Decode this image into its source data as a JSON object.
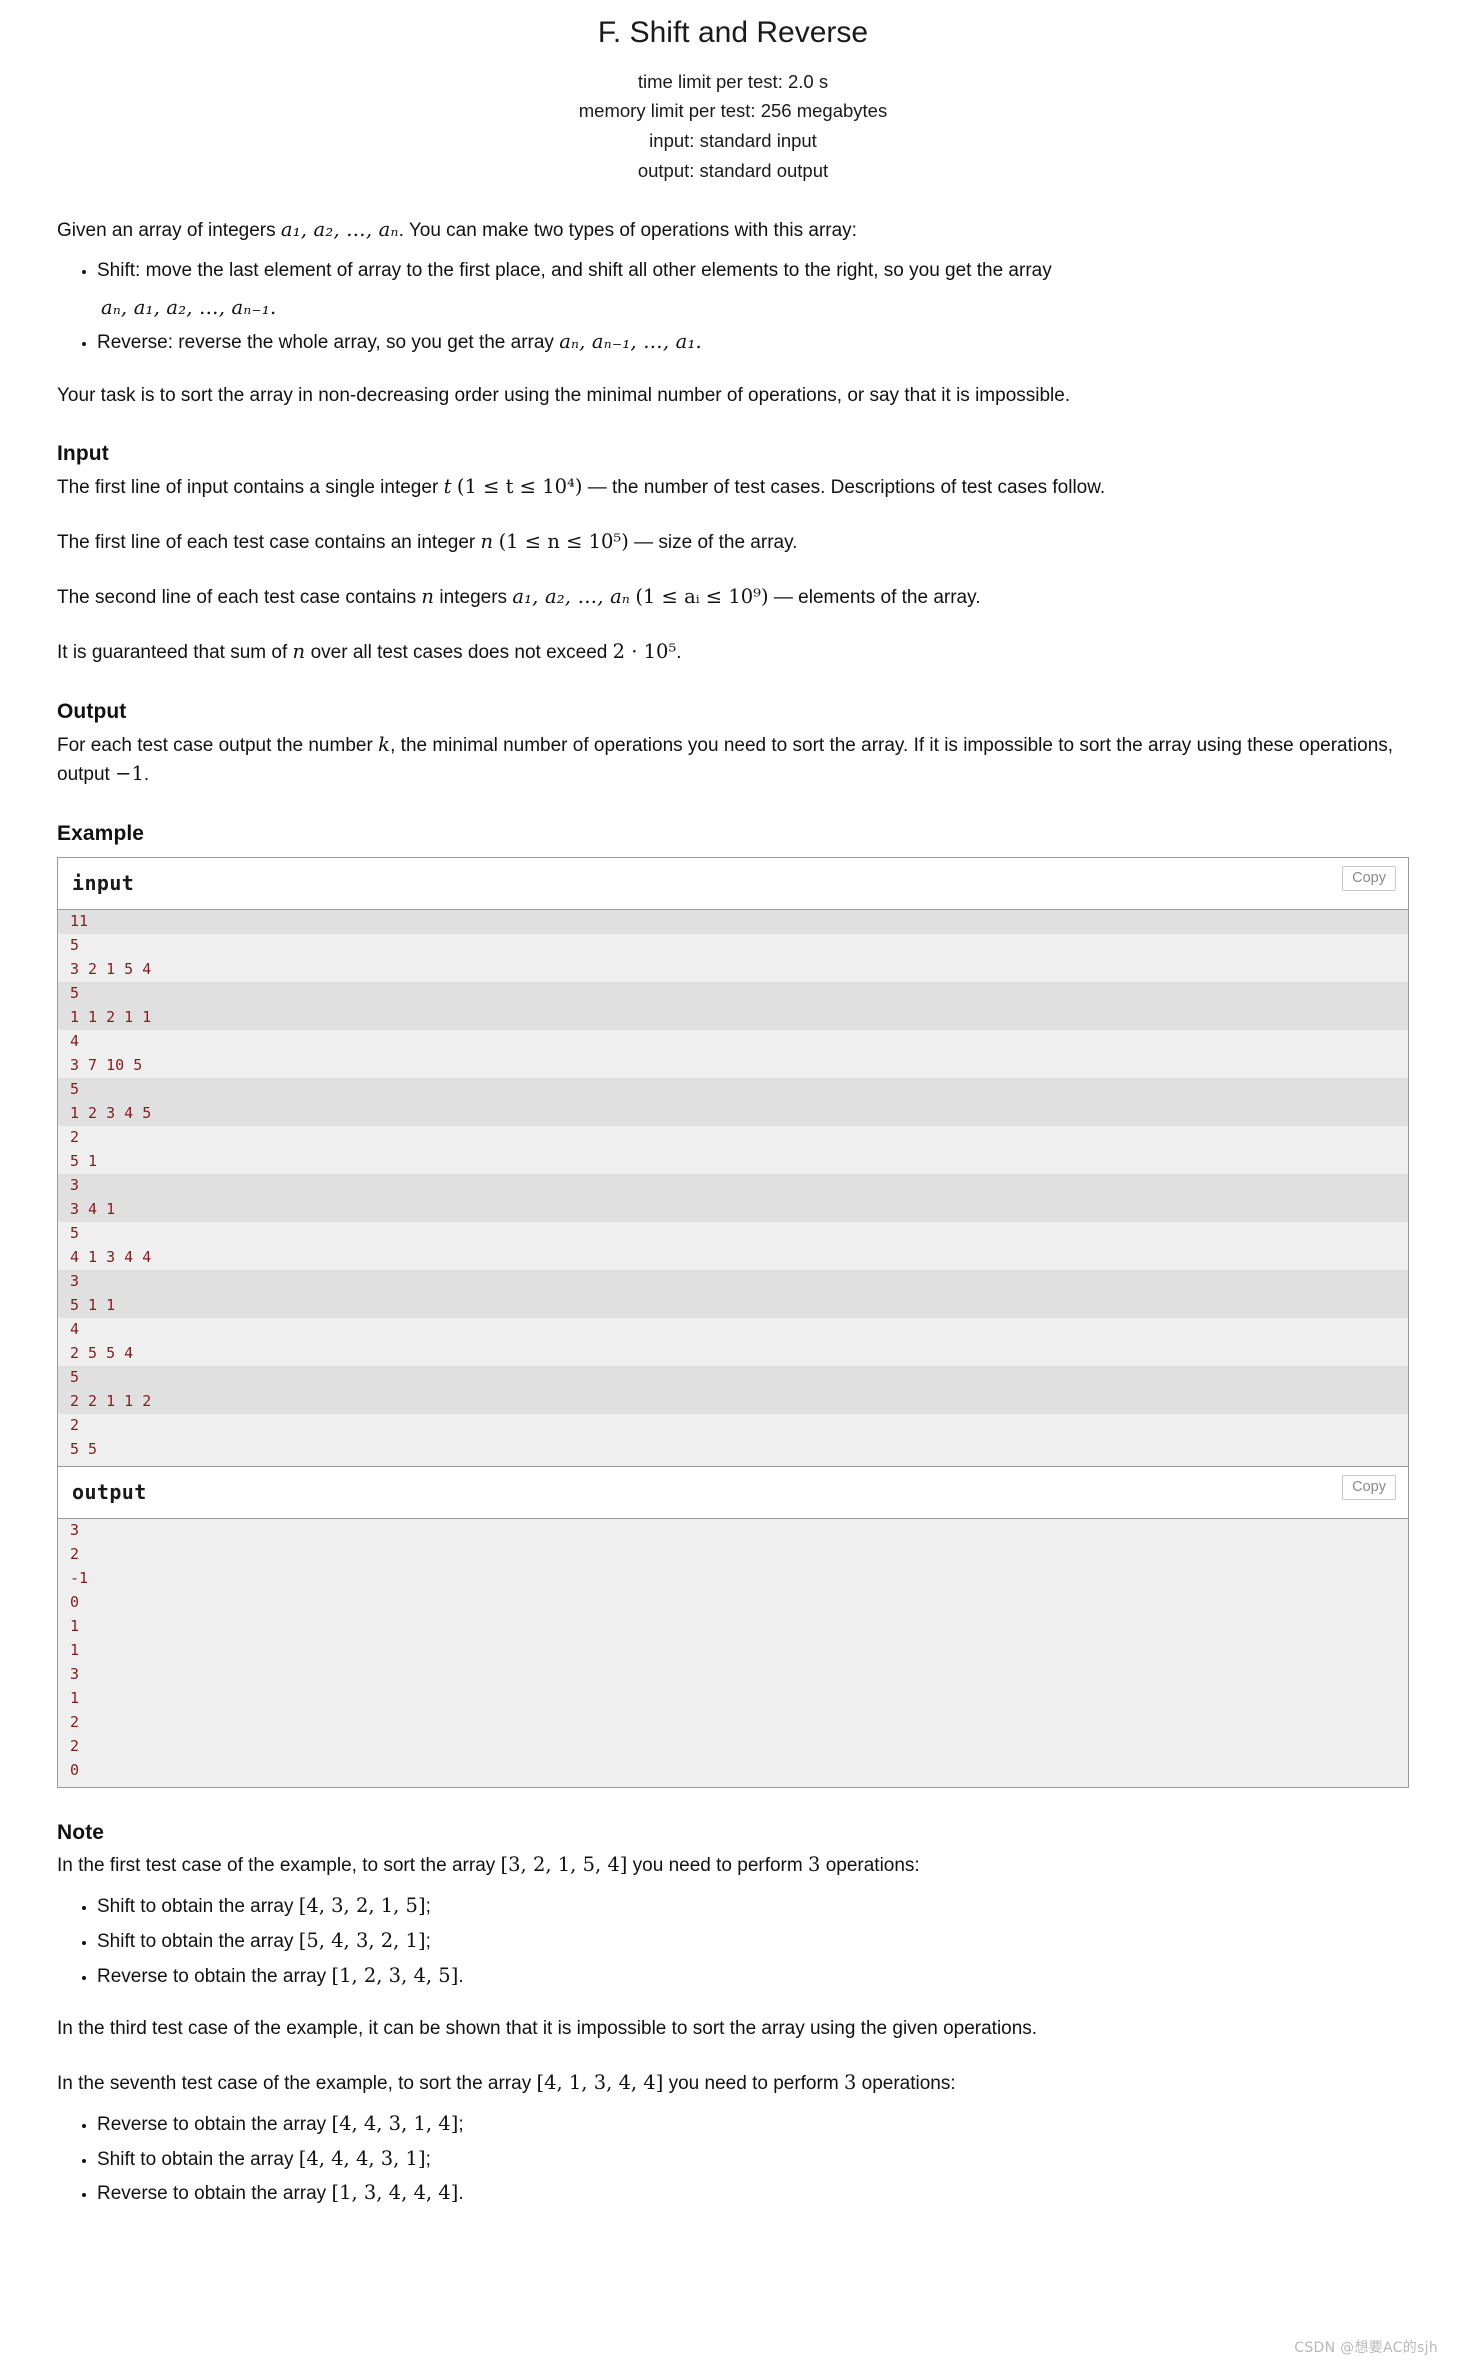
{
  "header": {
    "title": "F. Shift and Reverse",
    "time_limit": "time limit per test: 2.0 s",
    "memory_limit": "memory limit per test: 256 megabytes",
    "input_spec": "input: standard input",
    "output_spec": "output: standard output"
  },
  "statement": {
    "intro_before_math": "Given an array of integers ",
    "intro_math": "a₁, a₂, …, aₙ",
    "intro_after_math": ". You can make two types of operations with this array:",
    "bullets": [
      {
        "text": "Shift: move the last element of array to the first place, and shift all other elements to the right, so you get the array",
        "formula": "aₙ, a₁, a₂, …, aₙ₋₁."
      },
      {
        "text": "Reverse: reverse the whole array, so you get the array",
        "formula": "aₙ, aₙ₋₁, …, a₁."
      }
    ],
    "task": "Your task is to sort the array in non-decreasing order using the minimal number of operations, or say that it is impossible."
  },
  "input_section": {
    "heading": "Input",
    "p1_a": "The first line of input contains a single integer ",
    "p1_math_var": "t",
    "p1_math_range": "(1 ≤ t ≤ 10⁴)",
    "p1_b": " — the number of test cases. Descriptions of test cases follow.",
    "p2_a": "The first line of each test case contains an integer ",
    "p2_math_var": "n",
    "p2_math_range": "(1 ≤ n ≤ 10⁵)",
    "p2_b": " — size of the array.",
    "p3_a": "The second line of each test case contains ",
    "p3_math_n": "n",
    "p3_mid": " integers ",
    "p3_math_arr": "a₁, a₂, …, aₙ",
    "p3_math_range": "(1 ≤ aᵢ ≤ 10⁹)",
    "p3_b": " — elements of the array.",
    "p4_a": "It is guaranteed that sum of ",
    "p4_math_n": "n",
    "p4_b": " over all test cases does not exceed ",
    "p4_math_bound": "2 · 10⁵",
    "p4_c": "."
  },
  "output_section": {
    "heading": "Output",
    "p1_a": "For each test case output the number ",
    "p1_math_k": "k",
    "p1_b": ", the minimal number of operations you need to sort the array. If it is impossible to sort the array using these operations, output ",
    "p1_math_neg": "−1",
    "p1_c": "."
  },
  "example_section": {
    "heading": "Example",
    "input_label": "input",
    "output_label": "output",
    "copy_label": "Copy",
    "input_lines": [
      "11",
      "5",
      "3 2 1 5 4",
      "5",
      "1 1 2 1 1",
      "4",
      "3 7 10 5",
      "5",
      "1 2 3 4 5",
      "2",
      "5 1",
      "3",
      "3 4 1",
      "5",
      "4 1 3 4 4",
      "3",
      "5 1 1",
      "4",
      "2 5 5 4",
      "5",
      "2 2 1 1 2",
      "2",
      "5 5"
    ],
    "output_lines": [
      "3",
      "2",
      "-1",
      "0",
      "1",
      "1",
      "3",
      "1",
      "2",
      "2",
      "0"
    ]
  },
  "note_section": {
    "heading": "Note",
    "p1_a": "In the first test case of the example, to sort the array ",
    "p1_array": "[3, 2, 1, 5, 4]",
    "p1_b": " you need to perform ",
    "p1_count": "3",
    "p1_c": " operations:",
    "bullets1": [
      {
        "text": "Shift to obtain the array ",
        "array": "[4, 3, 2, 1, 5]",
        "tail": ";"
      },
      {
        "text": "Shift to obtain the array ",
        "array": "[5, 4, 3, 2, 1]",
        "tail": ";"
      },
      {
        "text": "Reverse to obtain the array ",
        "array": "[1, 2, 3, 4, 5]",
        "tail": "."
      }
    ],
    "p2": "In the third test case of the example, it can be shown that it is impossible to sort the array using the given operations.",
    "p3_a": "In the seventh test case of the example, to sort the array ",
    "p3_array": "[4, 1, 3, 4, 4]",
    "p3_b": " you need to perform ",
    "p3_count": "3",
    "p3_c": " operations:",
    "bullets2": [
      {
        "text": "Reverse to obtain the array ",
        "array": "[4, 4, 3, 1, 4]",
        "tail": ";"
      },
      {
        "text": "Shift to obtain the array ",
        "array": "[4, 4, 4, 3, 1]",
        "tail": ";"
      },
      {
        "text": "Reverse to obtain the array ",
        "array": "[1, 3, 4, 4, 4]",
        "tail": "."
      }
    ]
  },
  "watermark": "CSDN @想要AC的sjh",
  "colors": {
    "sample_text": "#8b1a1a",
    "sample_bg": "#efefef",
    "sample_bg_alt": "#e0e0e0",
    "border": "#9a9a9a"
  }
}
